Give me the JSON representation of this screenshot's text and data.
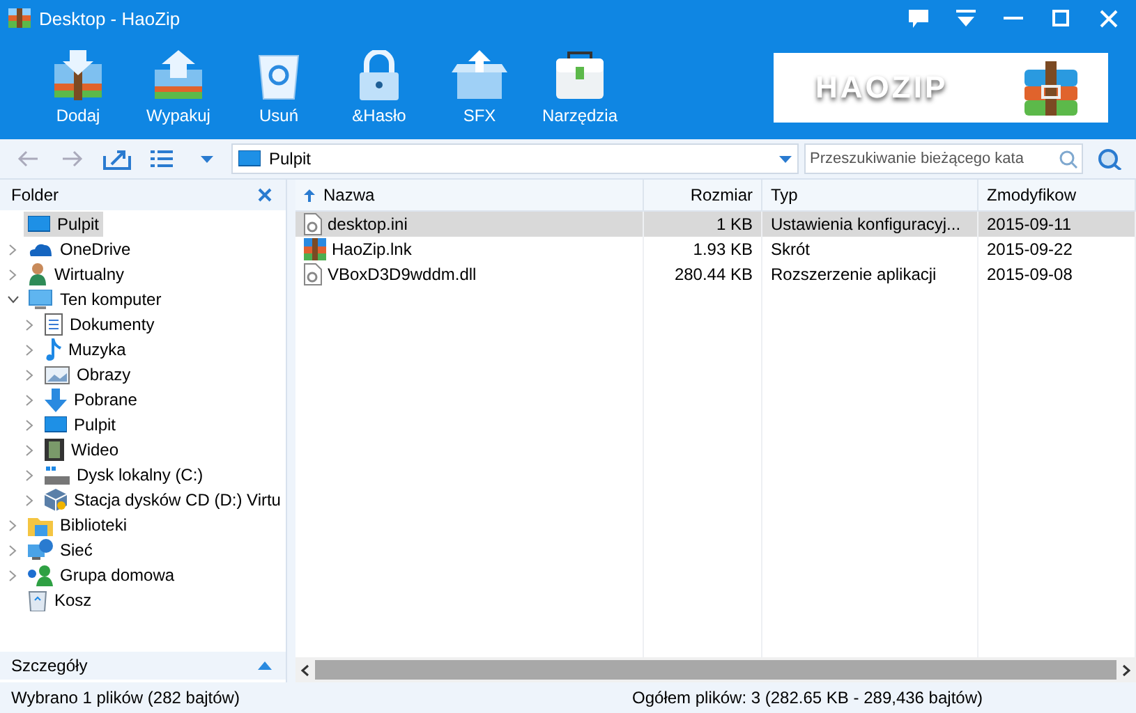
{
  "window": {
    "title": "Desktop - HaoZip"
  },
  "toolbar": [
    {
      "label": "Dodaj",
      "kind": "add"
    },
    {
      "label": "Wypakuj",
      "kind": "extract"
    },
    {
      "label": "Usuń",
      "kind": "delete"
    },
    {
      "label": "&Hasło",
      "kind": "password"
    },
    {
      "label": "SFX",
      "kind": "sfx"
    },
    {
      "label": "Narzędzia",
      "kind": "tools"
    }
  ],
  "banner": {
    "text": "HAOZIP"
  },
  "address": {
    "value": "Pulpit"
  },
  "search": {
    "placeholder": "Przeszukiwanie bieżącego kata"
  },
  "sidebar": {
    "title": "Folder",
    "items": [
      {
        "label": "Pulpit",
        "kind": "desktop",
        "selected": true,
        "expandable": false
      },
      {
        "label": "OneDrive",
        "kind": "cloud",
        "selected": false,
        "expandable": true
      },
      {
        "label": "Wirtualny",
        "kind": "user",
        "selected": false,
        "expandable": true
      },
      {
        "label": "Ten komputer",
        "kind": "computer",
        "selected": false,
        "expandable": true,
        "expanded": true,
        "children": [
          {
            "label": "Dokumenty",
            "kind": "documents",
            "selected": false,
            "expandable": true
          },
          {
            "label": "Muzyka",
            "kind": "music",
            "selected": false,
            "expandable": true
          },
          {
            "label": "Obrazy",
            "kind": "pictures",
            "selected": false,
            "expandable": true
          },
          {
            "label": "Pobrane",
            "kind": "downloads",
            "selected": false,
            "expandable": true
          },
          {
            "label": "Pulpit",
            "kind": "desktop",
            "selected": false,
            "expandable": true
          },
          {
            "label": "Wideo",
            "kind": "video",
            "selected": false,
            "expandable": true
          },
          {
            "label": "Dysk lokalny (C:)",
            "kind": "drive",
            "selected": false,
            "expandable": true
          },
          {
            "label": "Stacja dysków CD (D:) Virtu",
            "kind": "cd",
            "selected": false,
            "expandable": true
          }
        ]
      },
      {
        "label": "Biblioteki",
        "kind": "library",
        "selected": false,
        "expandable": true
      },
      {
        "label": "Sieć",
        "kind": "network",
        "selected": false,
        "expandable": true
      },
      {
        "label": "Grupa domowa",
        "kind": "homegroup",
        "selected": false,
        "expandable": true
      },
      {
        "label": "Kosz",
        "kind": "trash",
        "selected": false,
        "expandable": false
      }
    ]
  },
  "details_panel": {
    "title": "Szczegóły"
  },
  "table": {
    "columns": [
      "Nazwa",
      "Rozmiar",
      "Typ",
      "Zmodyfikow"
    ],
    "rows": [
      {
        "name": "desktop.ini",
        "kind": "settings",
        "size": "1 KB",
        "type": "Ustawienia konfiguracyj...",
        "modified": "2015-09-11",
        "selected": true
      },
      {
        "name": "HaoZip.lnk",
        "kind": "archive",
        "size": "1.93 KB",
        "type": "Skrót",
        "modified": "2015-09-22",
        "selected": false
      },
      {
        "name": "VBoxD3D9wddm.dll",
        "kind": "settings",
        "size": "280.44 KB",
        "type": "Rozszerzenie aplikacji",
        "modified": "2015-09-08",
        "selected": false
      }
    ]
  },
  "status_bar": {
    "left": "Wybrano 1 plików (282 bajtów)",
    "right": "Ogółem plików: 3 (282.65 KB - 289,436 bajtów)"
  }
}
